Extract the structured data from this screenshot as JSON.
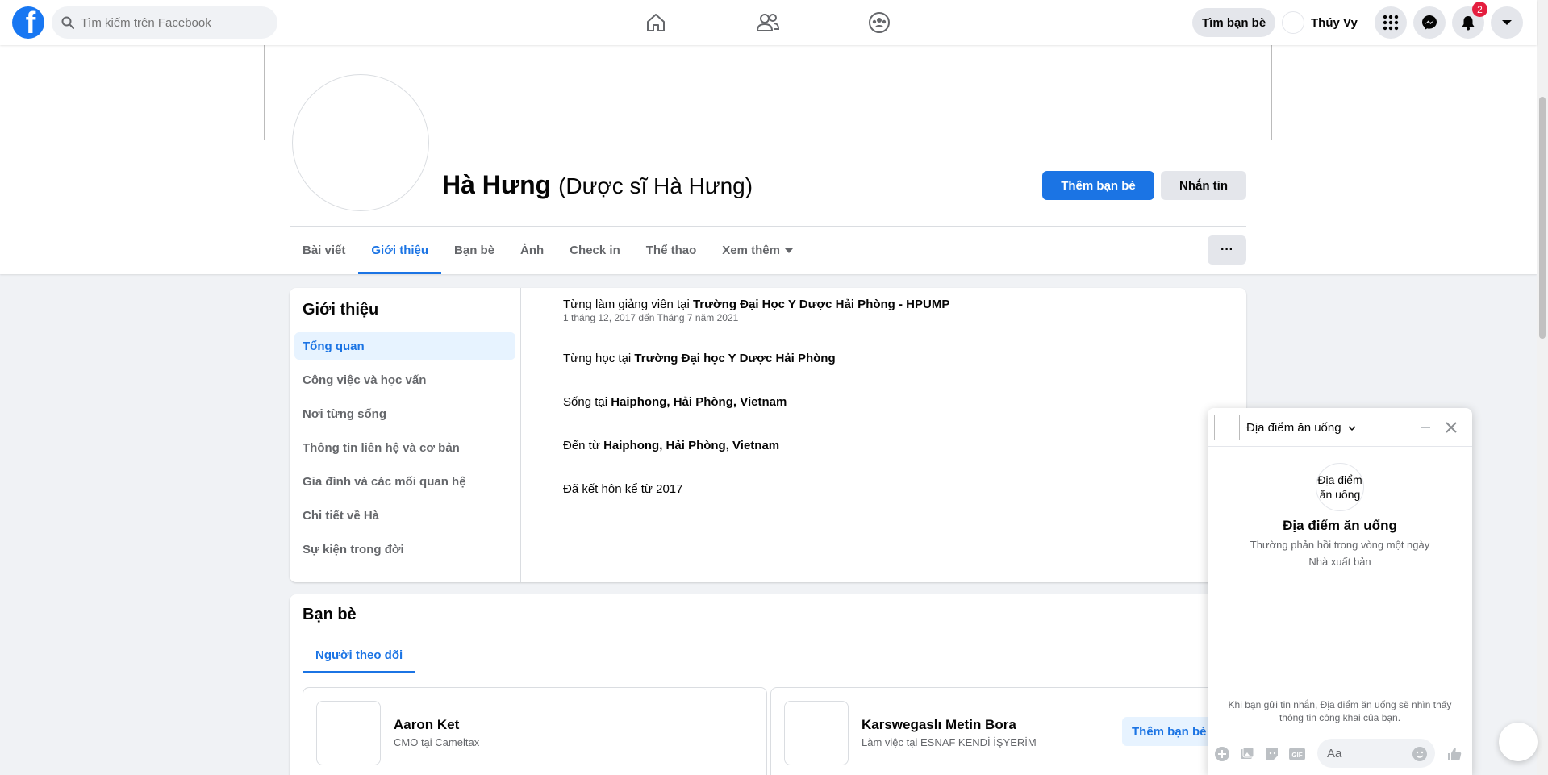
{
  "topbar": {
    "logo": "f",
    "search_placeholder": "Tìm kiếm trên Facebook",
    "nav_icons": [
      "home-icon",
      "friends-icon",
      "groups-icon"
    ],
    "find_friends_label": "Tìm bạn bè",
    "user_name": "Thúy Vy",
    "notification_count": "2",
    "right_icons": [
      "menu-grid-icon",
      "messenger-icon",
      "bell-icon",
      "account-caret-icon"
    ]
  },
  "profile": {
    "name": "Hà Hưng",
    "alternate_name": "(Dược sĩ Hà Hưng)",
    "add_friend_label": "Thêm bạn bè",
    "message_label": "Nhắn tin",
    "more_label": "···"
  },
  "tabs": [
    {
      "label": "Bài viết",
      "active": false
    },
    {
      "label": "Giới thiệu",
      "active": true
    },
    {
      "label": "Bạn bè",
      "active": false
    },
    {
      "label": "Ảnh",
      "active": false
    },
    {
      "label": "Check in",
      "active": false
    },
    {
      "label": "Thể thao",
      "active": false
    },
    {
      "label": "Xem thêm",
      "active": false
    }
  ],
  "about": {
    "title": "Giới thiệu",
    "sections": [
      {
        "label": "Tổng quan",
        "active": true
      },
      {
        "label": "Công việc và học vấn",
        "active": false
      },
      {
        "label": "Nơi từng sống",
        "active": false
      },
      {
        "label": "Thông tin liên hệ và cơ bản",
        "active": false
      },
      {
        "label": "Gia đình và các mối quan hệ",
        "active": false
      },
      {
        "label": "Chi tiết về Hà",
        "active": false
      },
      {
        "label": "Sự kiện trong đời",
        "active": false
      }
    ],
    "items": [
      {
        "prefix": "Từng làm giảng viên tại ",
        "bold": "Trường Đại Học Y Dược Hải Phòng - HPUMP",
        "sub": "1 tháng 12, 2017 đến Tháng 7 năm 2021"
      },
      {
        "prefix": "Từng học tại ",
        "bold": "Trường Đại học Y Dược Hải Phòng",
        "sub": ""
      },
      {
        "prefix": "Sống tại ",
        "bold": "Haiphong, Hải Phòng, Vietnam",
        "sub": ""
      },
      {
        "prefix": "Đến từ ",
        "bold": "Haiphong, Hải Phòng, Vietnam",
        "sub": ""
      },
      {
        "prefix": "Đã kết hôn kể từ 2017",
        "bold": "",
        "sub": ""
      }
    ]
  },
  "friends": {
    "title": "Bạn bè",
    "tab_label": "Người theo dõi",
    "people": [
      {
        "name": "Aaron Ket",
        "subtitle": "CMO tại Cameltax",
        "button": ""
      },
      {
        "name": "Karswegaslı Metin Bora",
        "subtitle": "Làm việc tại ESNAF KENDİ İŞYERİM",
        "button": "Thêm bạn bè"
      }
    ]
  },
  "chat": {
    "name": "Địa điểm ăn uống",
    "avatar_alt": "Địa điểm ăn uống",
    "title": "Địa điểm ăn uống",
    "response_time": "Thường phản hồi trong vòng một ngày",
    "role": "Nhà xuất bản",
    "privacy_note": "Khi bạn gửi tin nhắn, Địa điểm ăn uống sẽ nhìn thấy thông tin công khai của bạn.",
    "input_placeholder": "Aa",
    "gif_label": "GIF"
  },
  "colors": {
    "brand": "#1877f2",
    "primary_button": "#1b74e4",
    "background": "#f0f2f5",
    "notification": "#e41e3f"
  }
}
